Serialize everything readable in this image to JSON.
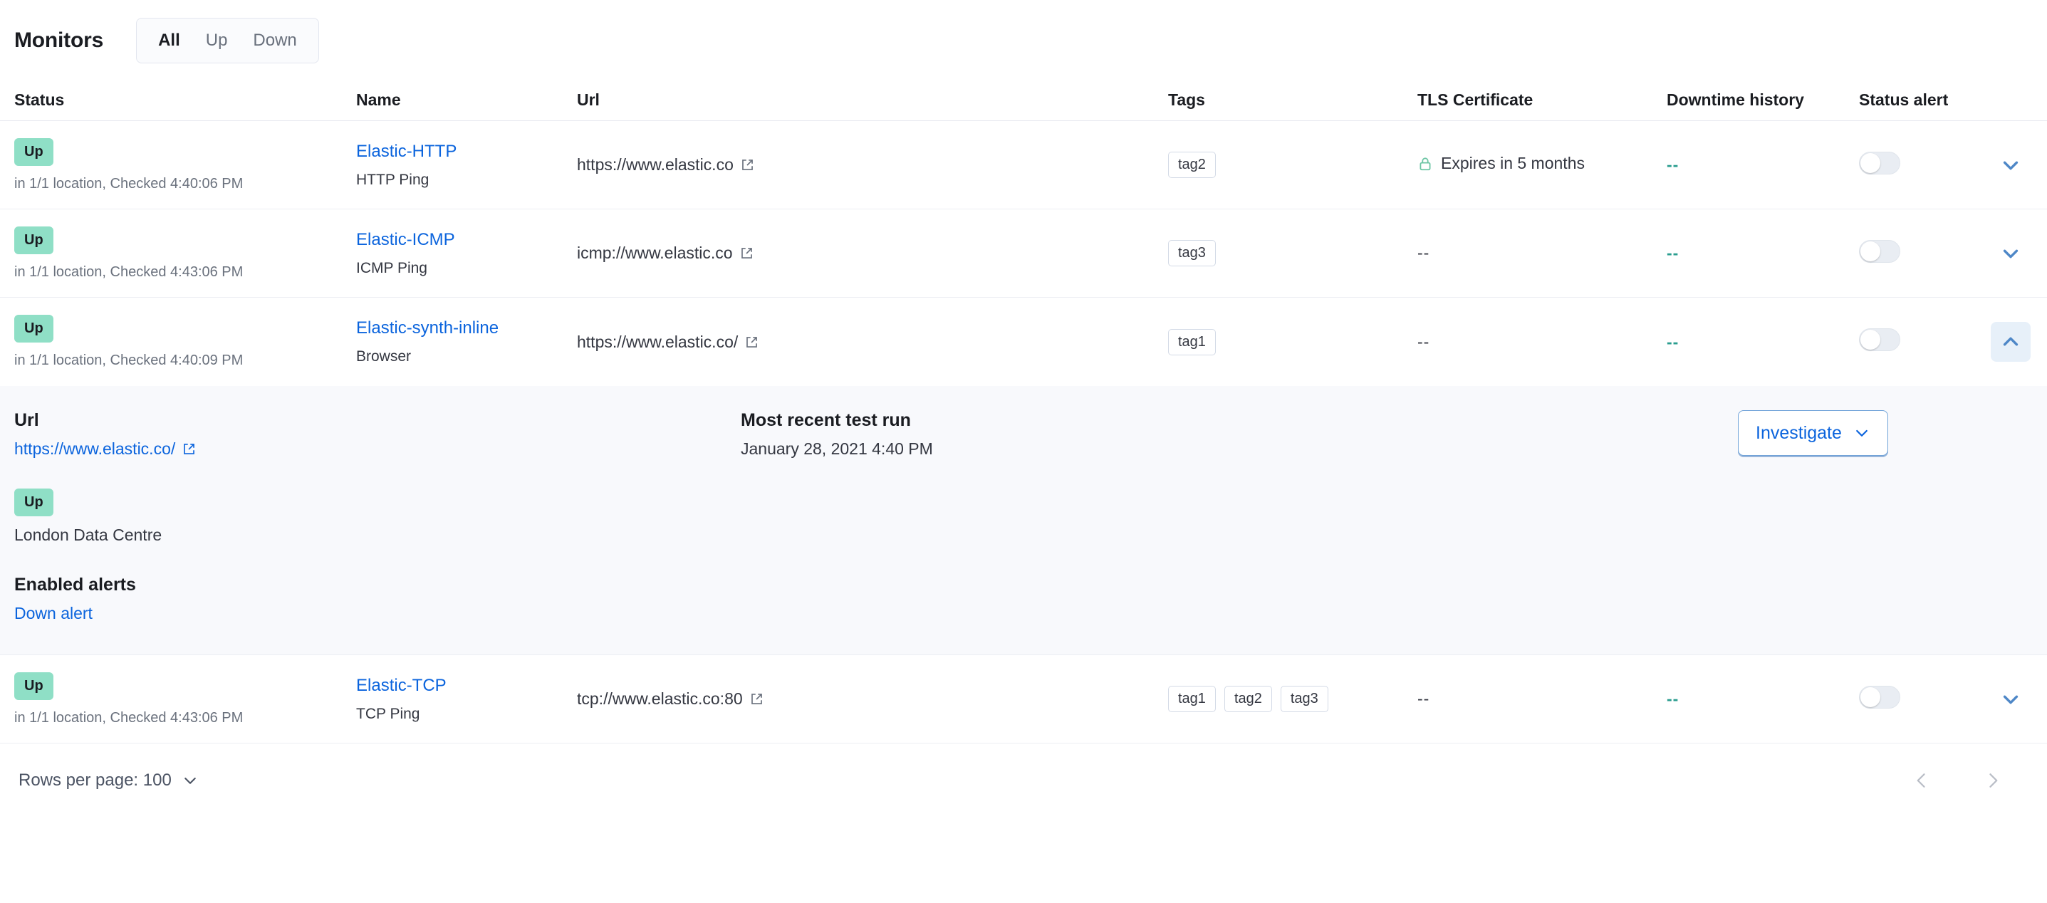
{
  "header": {
    "title": "Monitors",
    "filters": [
      {
        "label": "All",
        "selected": true
      },
      {
        "label": "Up",
        "selected": false
      },
      {
        "label": "Down",
        "selected": false
      }
    ]
  },
  "table": {
    "columns": {
      "status": "Status",
      "name": "Name",
      "url": "Url",
      "tags": "Tags",
      "tls": "TLS Certificate",
      "downtime": "Downtime history",
      "alert": "Status alert"
    },
    "rows": [
      {
        "status_badge": "Up",
        "status_sub": "in 1/1 location, Checked 4:40:06 PM",
        "name": "Elastic-HTTP",
        "type": "HTTP Ping",
        "url": "https://www.elastic.co",
        "tags": [
          "tag2"
        ],
        "tls": "Expires in 5 months",
        "tls_has_lock": true,
        "downtime": "--",
        "alert_on": false,
        "expanded": false
      },
      {
        "status_badge": "Up",
        "status_sub": "in 1/1 location, Checked 4:43:06 PM",
        "name": "Elastic-ICMP",
        "type": "ICMP Ping",
        "url": "icmp://www.elastic.co",
        "tags": [
          "tag3"
        ],
        "tls": "--",
        "tls_has_lock": false,
        "downtime": "--",
        "alert_on": false,
        "expanded": false
      },
      {
        "status_badge": "Up",
        "status_sub": "in 1/1 location, Checked 4:40:09 PM",
        "name": "Elastic-synth-inline",
        "type": "Browser",
        "url": "https://www.elastic.co/",
        "tags": [
          "tag1"
        ],
        "tls": "--",
        "tls_has_lock": false,
        "downtime": "--",
        "alert_on": false,
        "expanded": true
      },
      {
        "status_badge": "Up",
        "status_sub": "in 1/1 location, Checked 4:43:06 PM",
        "name": "Elastic-TCP",
        "type": "TCP Ping",
        "url": "tcp://www.elastic.co:80",
        "tags": [
          "tag1",
          "tag2",
          "tag3"
        ],
        "tls": "--",
        "tls_has_lock": false,
        "downtime": "--",
        "alert_on": false,
        "expanded": false
      }
    ]
  },
  "detail": {
    "url_heading": "Url",
    "url_value": "https://www.elastic.co/",
    "status_badge": "Up",
    "location": "London Data Centre",
    "alerts_heading": "Enabled alerts",
    "alert_name": "Down alert",
    "recent_heading": "Most recent test run",
    "recent_value": "January 28, 2021 4:40 PM",
    "investigate_label": "Investigate"
  },
  "footer": {
    "rows_per_page": "Rows per page: 100"
  },
  "colors": {
    "up_badge_bg": "#8fdfc6",
    "link": "#0b64dd",
    "teal_dash": "#2a9d8f",
    "lock": "#6cc5a4",
    "panel_bg": "#f8f9fc"
  }
}
